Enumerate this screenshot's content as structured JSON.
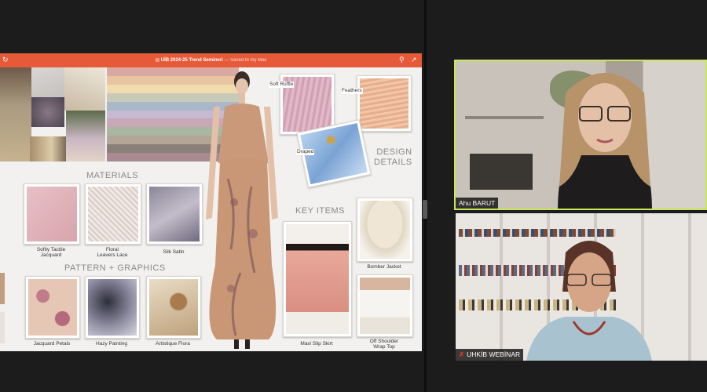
{
  "presentation": {
    "title": "UİB 2024-25 Trend Semineri",
    "save_status": "— Saved to my Mac",
    "sections": {
      "materials": "MATERIALS",
      "pattern_graphics": "PATTERN + GRAPHICS",
      "key_items": "KEY ITEMS",
      "design_details_line1": "DESIGN",
      "design_details_line2": "DETAILS"
    },
    "materials": [
      {
        "label_line1": "Softly Tactile",
        "label_line2": "Jacquard"
      },
      {
        "label_line1": "Floral",
        "label_line2": "Leavers Lace"
      },
      {
        "label_line1": "Silk Satin",
        "label_line2": ""
      }
    ],
    "patterns": [
      {
        "label": "Jacquard Petals"
      },
      {
        "label": "Hazy Painting"
      },
      {
        "label": "Artistique Flora"
      }
    ],
    "key_items": [
      {
        "label_line1": "Bomber Jacket",
        "label_line2": ""
      },
      {
        "label_line1": "Maxi Slip Skirt",
        "label_line2": ""
      },
      {
        "label_line1": "Off Shoulder",
        "label_line2": "Wrap Top"
      }
    ],
    "design_details": {
      "soft_ruffle": "Soft Ruffle",
      "feathers": "Feathers",
      "draped": "Draped"
    },
    "palette_colors": [
      "#d9a9a2",
      "#e8c4a3",
      "#f1dcae",
      "#c8c9b8",
      "#a8b8c8",
      "#c6b9d2",
      "#c8a8b4",
      "#a8b6a2",
      "#b4a696",
      "#8b7f7a",
      "#a88a90"
    ]
  },
  "participants": [
    {
      "name": "Ahu BARUT"
    },
    {
      "name": "UHKİB WEBİNAR"
    }
  ]
}
